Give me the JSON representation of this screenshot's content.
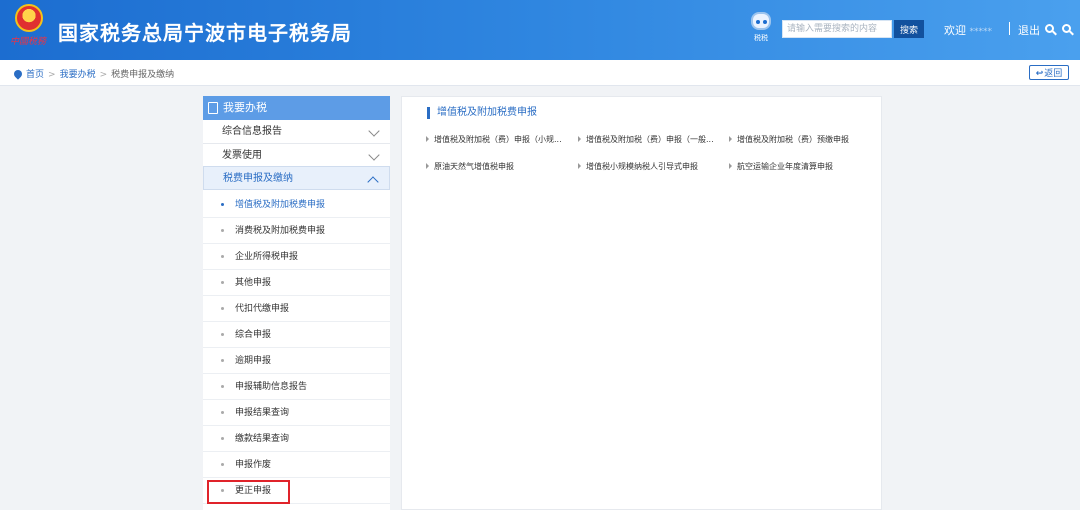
{
  "header": {
    "emblem_text": "中國税務",
    "title": "国家税务总局宁波市电子税务局",
    "assistant_label": "税税",
    "search_placeholder": "请输入需要搜索的内容",
    "search_button": "搜索",
    "welcome": "欢迎",
    "username": "*****",
    "logout": "退出"
  },
  "breadcrumb": {
    "home": "首页",
    "level1": "我要办税",
    "level2": "税费申报及缴纳",
    "separator": ">",
    "back": "返回"
  },
  "sidebar": {
    "header": "我要办税",
    "groups": [
      {
        "label": "综合信息报告"
      },
      {
        "label": "发票使用"
      },
      {
        "label": "税费申报及缴纳"
      }
    ],
    "items": [
      {
        "label": "增值税及附加税费申报"
      },
      {
        "label": "消费税及附加税费申报"
      },
      {
        "label": "企业所得税申报"
      },
      {
        "label": "其他申报"
      },
      {
        "label": "代扣代缴申报"
      },
      {
        "label": "综合申报"
      },
      {
        "label": "逾期申报"
      },
      {
        "label": "申报辅助信息报告"
      },
      {
        "label": "申报结果查询"
      },
      {
        "label": "缴款结果查询"
      },
      {
        "label": "申报作废"
      },
      {
        "label": "更正申报"
      }
    ]
  },
  "main": {
    "section_title": "增值税及附加税费申报",
    "entries": [
      {
        "label": "增值税及附加税（费）申报（小规..."
      },
      {
        "label": "增值税及附加税（费）申报（一般..."
      },
      {
        "label": "增值税及附加税（费）预缴申报"
      },
      {
        "label": "原油天然气增值税申报"
      },
      {
        "label": "增值税小规模纳税人引导式申报"
      },
      {
        "label": "航空运输企业年度清算申报"
      }
    ]
  },
  "colors": {
    "header_blue": "#1c6dd0",
    "accent": "#2a6dc4",
    "highlight_red": "#e0232a"
  }
}
